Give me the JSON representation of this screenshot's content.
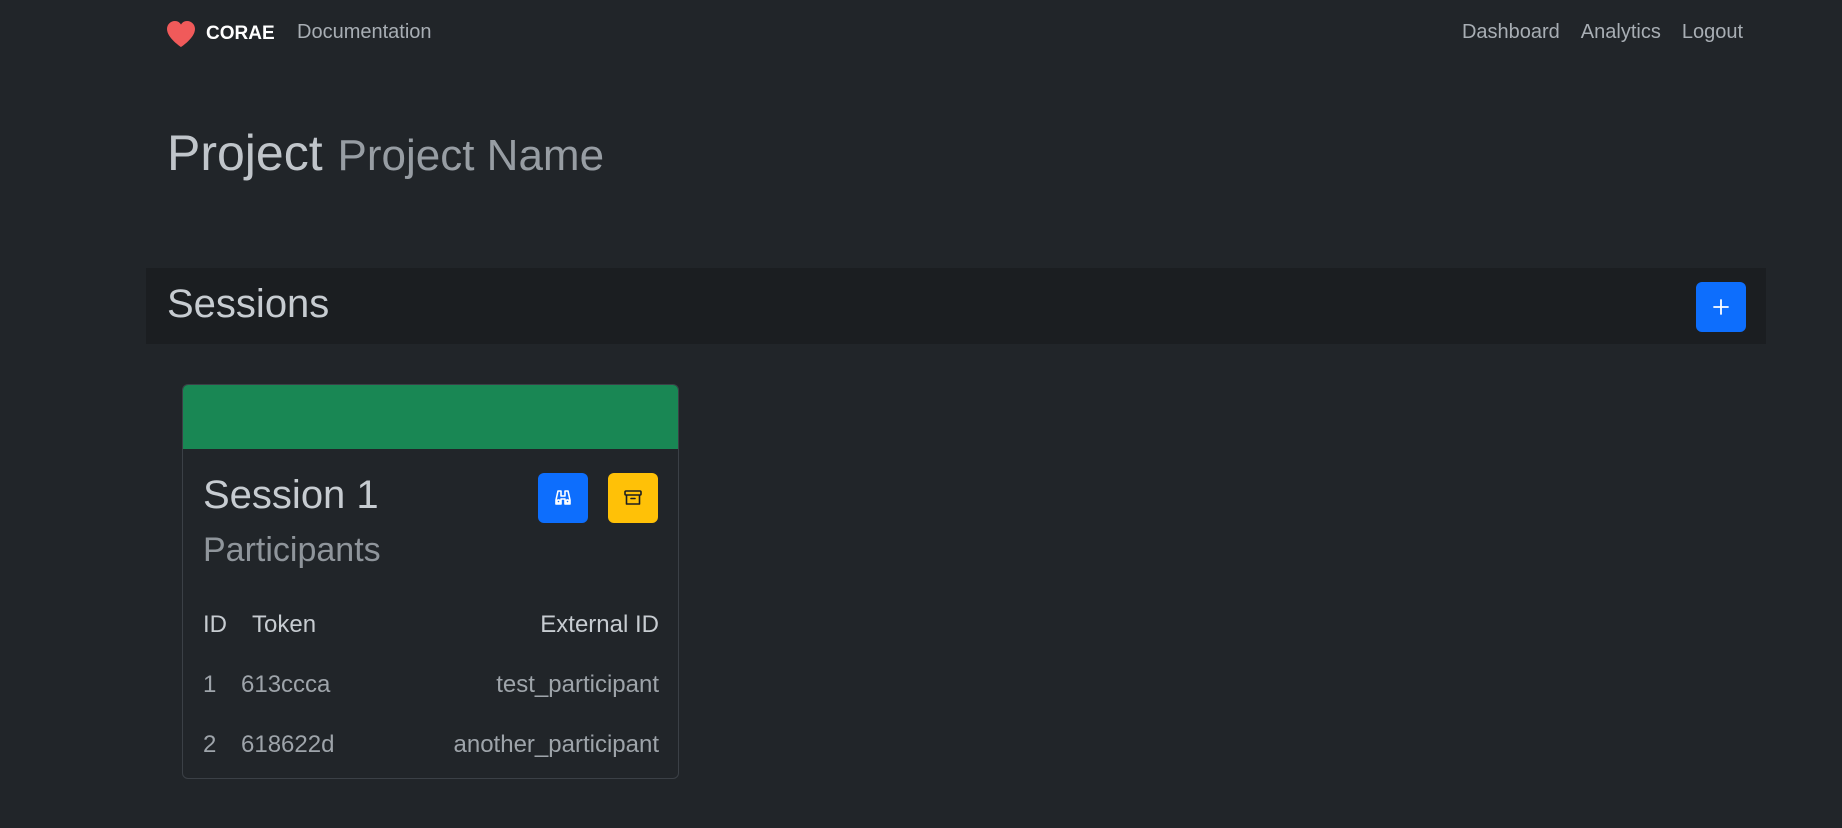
{
  "navbar": {
    "brand": "CORAE",
    "left_links": [
      {
        "label": "Documentation"
      }
    ],
    "right_links": [
      {
        "label": "Dashboard"
      },
      {
        "label": "Analytics"
      },
      {
        "label": "Logout"
      }
    ]
  },
  "project": {
    "label": "Project",
    "name": "Project Name"
  },
  "sessions": {
    "title": "Sessions",
    "add_icon": "plus-icon"
  },
  "session_card": {
    "title": "Session 1",
    "subtitle": "Participants",
    "header_color": "#198754",
    "view_icon": "binoculars-icon",
    "archive_icon": "archive-icon",
    "table": {
      "columns": [
        "ID",
        "Token",
        "External ID"
      ],
      "rows": [
        {
          "id": "1",
          "token": "613ccca",
          "external_id": "test_participant"
        },
        {
          "id": "2",
          "token": "618622d",
          "external_id": "another_participant"
        }
      ]
    }
  },
  "colors": {
    "background": "#212529",
    "primary": "#0d6efd",
    "warning": "#ffc107",
    "success": "#198754",
    "brand_heart": "#f05a5a"
  }
}
